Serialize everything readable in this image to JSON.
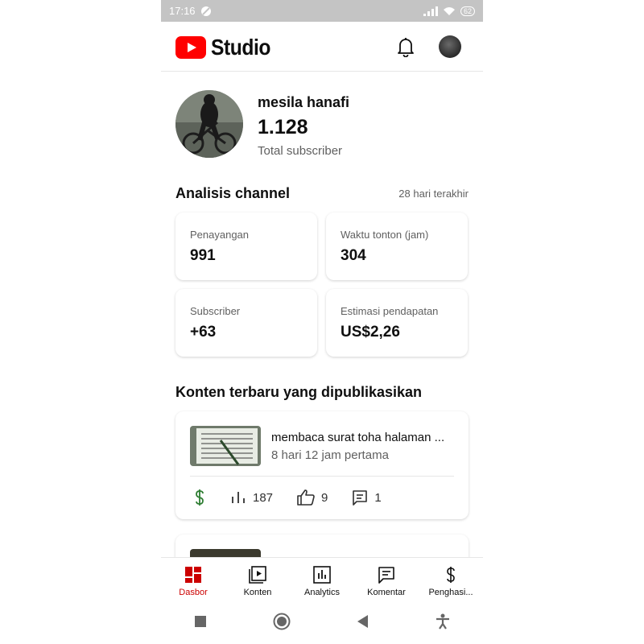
{
  "status_bar": {
    "time": "17:16",
    "battery": "62"
  },
  "app": {
    "title": "Studio",
    "brand_color": "#ff0000"
  },
  "channel": {
    "name": "mesila hanafi",
    "subscribers": "1.128",
    "subscribers_label": "Total subscriber"
  },
  "analytics": {
    "title": "Analisis channel",
    "period": "28 hari terakhir",
    "cards": [
      {
        "label": "Penayangan",
        "value": "991"
      },
      {
        "label": "Waktu tonton (jam)",
        "value": "304"
      },
      {
        "label": "Subscriber",
        "value": "+63"
      },
      {
        "label": "Estimasi pendapatan",
        "value": "US$2,26"
      }
    ]
  },
  "recent": {
    "title": "Konten terbaru yang dipublikasikan",
    "videos": [
      {
        "title": "membaca surat toha halaman ...",
        "subtitle": "8 hari 12 jam pertama",
        "views": "187",
        "likes": "9",
        "comments": "1"
      }
    ]
  },
  "bottom_nav": [
    {
      "label": "Dasbor",
      "icon": "dashboard-icon",
      "active": true
    },
    {
      "label": "Konten",
      "icon": "content-icon"
    },
    {
      "label": "Analytics",
      "icon": "analytics-icon"
    },
    {
      "label": "Komentar",
      "icon": "comments-icon"
    },
    {
      "label": "Penghasi...",
      "icon": "monetization-icon"
    }
  ],
  "colors": {
    "active": "#cc0000",
    "money": "#2e7d32",
    "muted": "#606060"
  }
}
